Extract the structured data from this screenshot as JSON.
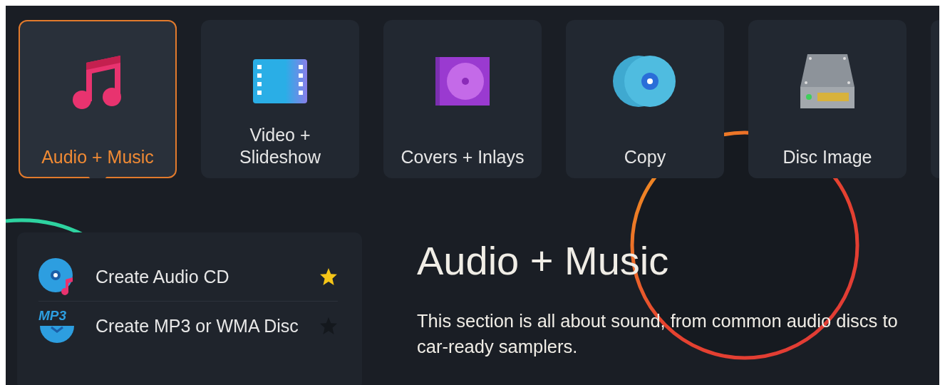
{
  "categories": [
    {
      "label": "Audio + Music",
      "selected": true
    },
    {
      "label": "Video + Slideshow",
      "selected": false
    },
    {
      "label": "Covers + Inlays",
      "selected": false
    },
    {
      "label": "Copy",
      "selected": false
    },
    {
      "label": "Disc Image",
      "selected": false
    },
    {
      "selected": false
    }
  ],
  "menu": {
    "items": [
      {
        "label": "Create Audio CD",
        "favorite": true
      },
      {
        "label": "Create MP3 or WMA Disc",
        "icon_text": "MP3",
        "favorite": false
      }
    ]
  },
  "section": {
    "title": "Audio + Music",
    "description": "This section is all about sound, from common audio discs to car-ready samplers."
  }
}
